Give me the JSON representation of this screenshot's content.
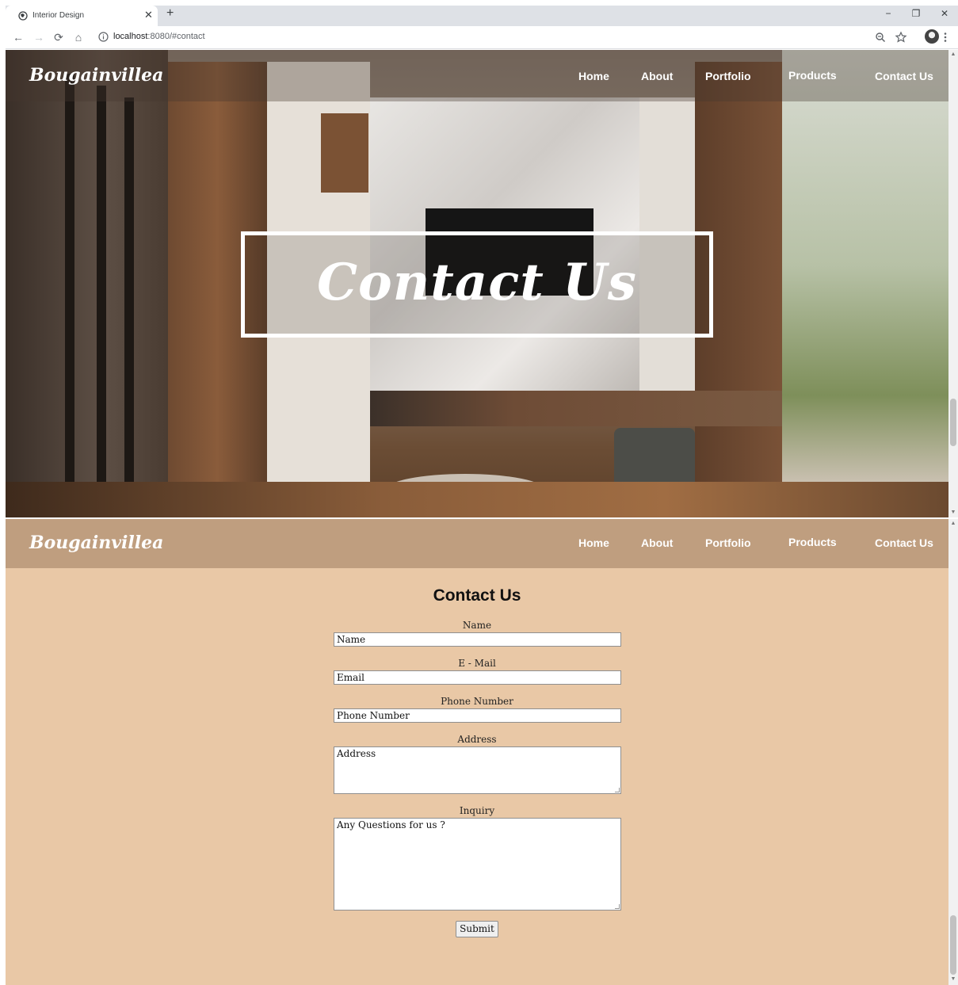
{
  "browser": {
    "tab_title": "Interior Design",
    "tab_close": "✕",
    "new_tab": "+",
    "url_host": "localhost",
    "url_rest": ":8080/#contact",
    "minimize": "−",
    "restore": "❐",
    "close": "✕",
    "back": "←",
    "forward": "→",
    "reload": "⟳",
    "home": "⌂"
  },
  "hero": {
    "brand": "Bougainvillea",
    "nav": [
      "Home",
      "About",
      "Portfolio",
      "Products",
      "Contact Us"
    ],
    "title": "Contact Us"
  },
  "header": {
    "brand": "Bougainvillea",
    "nav": [
      "Home",
      "About",
      "Portfolio",
      "Products",
      "Contact Us"
    ]
  },
  "form": {
    "title": "Contact Us",
    "name_label": "Name",
    "name_placeholder": "Name",
    "email_label": "E - Mail",
    "email_placeholder": "Email",
    "phone_label": "Phone Number",
    "phone_placeholder": "Phone Number",
    "address_label": "Address",
    "address_placeholder": "Address",
    "inquiry_label": "Inquiry",
    "inquiry_placeholder": "Any Questions for us ?",
    "submit": "Submit"
  },
  "colors": {
    "section_bg": "#e9c8a6",
    "nav_bg": "#bf9e7f"
  }
}
